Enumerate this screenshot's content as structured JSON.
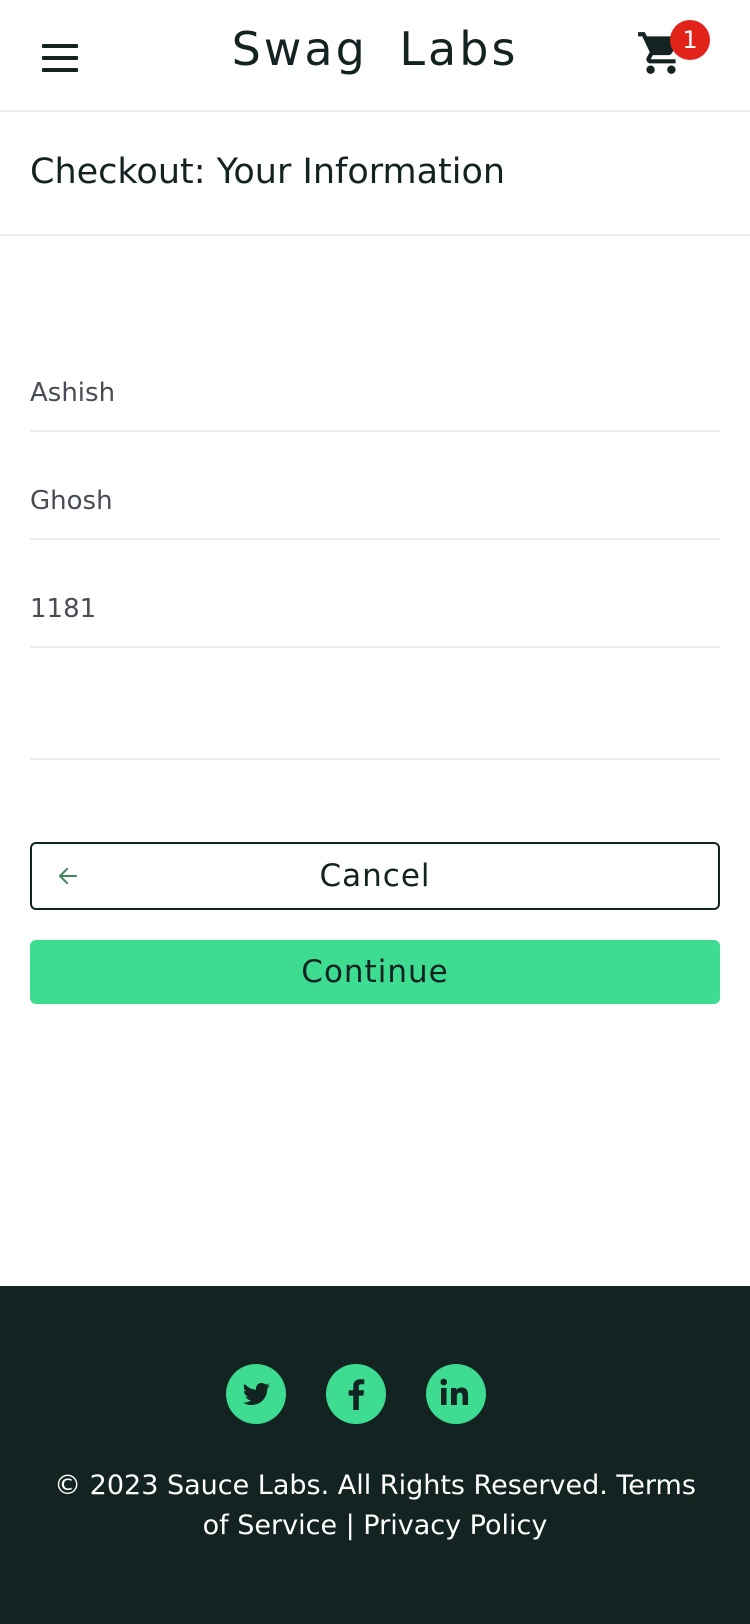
{
  "header": {
    "title": "Swag Labs",
    "cart_count": "1",
    "icons": {
      "menu": "hamburger-menu-icon",
      "cart": "shopping-cart-icon"
    }
  },
  "page": {
    "title": "Checkout: Your Information"
  },
  "form": {
    "first_name": {
      "value": "Ashish"
    },
    "last_name": {
      "value": "Ghosh"
    },
    "postal_code": {
      "value": "1181"
    },
    "extra": {
      "value": ""
    }
  },
  "actions": {
    "cancel_label": "Cancel",
    "continue_label": "Continue"
  },
  "footer": {
    "social": [
      "twitter-icon",
      "facebook-icon",
      "linkedin-icon"
    ],
    "copy": "© 2023 Sauce Labs. All Rights Reserved. Terms of Service | Privacy Policy"
  },
  "colors": {
    "dark": "#132322",
    "accent": "#3ddc91",
    "badge": "#e2231a",
    "divider": "#ededef"
  }
}
